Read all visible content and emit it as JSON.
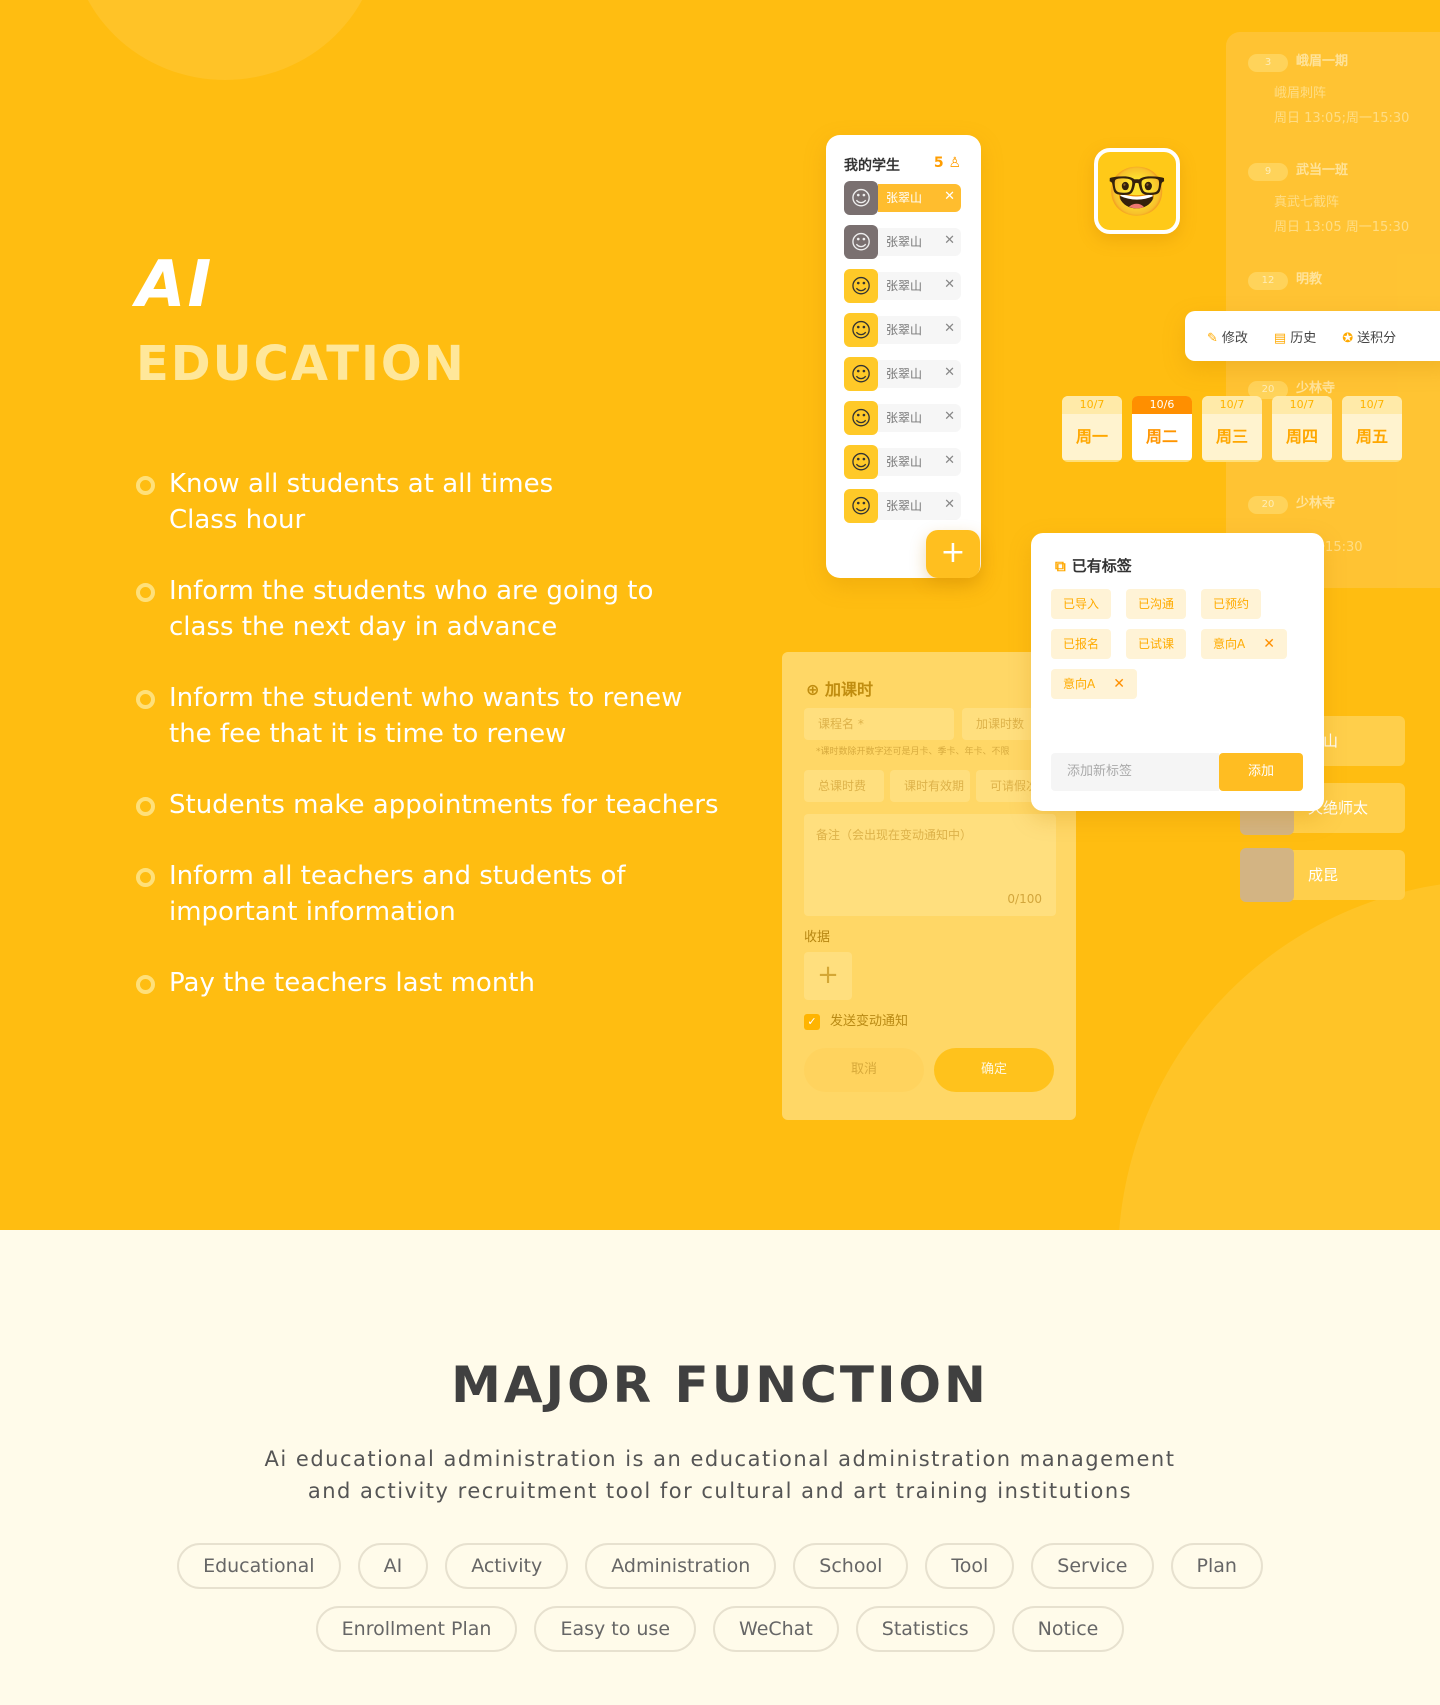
{
  "hero": {
    "title_ai": "AI",
    "title_education": "EDUCATION",
    "features": [
      "Know all students at all times\nClass hour",
      "Inform the students who are going to\nclass the next day in advance",
      "Inform the student who wants to renew\nthe fee that it is time to renew",
      "Students make appointments for teachers",
      "Inform all teachers and students of\nimportant information",
      "Pay the teachers last month"
    ]
  },
  "students_panel": {
    "title": "我的学生",
    "count": "5",
    "students": [
      "张翠山",
      "张翠山",
      "张翠山",
      "张翠山",
      "张翠山",
      "张翠山",
      "张翠山",
      "张翠山"
    ],
    "close_glyph": "✕",
    "add_glyph": "+"
  },
  "schedule": {
    "items": [
      {
        "badge": "3",
        "title": "峨眉一期",
        "line1": "峨眉刺阵",
        "line2": "周日 13:05;周一15:30"
      },
      {
        "badge": "9",
        "title": "武当一班",
        "line1": "真武七截阵",
        "line2": "周日 13:05 周一15:30"
      },
      {
        "badge": "12",
        "title": "明教",
        "line1": "",
        "line2": ""
      },
      {
        "badge": "20",
        "title": "少林寺",
        "line1": "",
        "line2": ""
      },
      {
        "badge": "20",
        "title": "少林寺",
        "line1": "",
        "line2": ":05 周一15:30"
      }
    ]
  },
  "action_bar": {
    "edit": "修改",
    "history": "历史",
    "points": "送积分"
  },
  "days": [
    {
      "date": "10/7",
      "weekday": "周一",
      "active": false
    },
    {
      "date": "10/6",
      "weekday": "周二",
      "active": true
    },
    {
      "date": "10/7",
      "weekday": "周三",
      "active": false
    },
    {
      "date": "10/7",
      "weekday": "周四",
      "active": false
    },
    {
      "date": "10/7",
      "weekday": "周五",
      "active": false
    }
  ],
  "add_class": {
    "title": "加课时",
    "course_name": "课程名 *",
    "hours": "加课时数",
    "hint": "*课时数除开数字还可是月卡、季卡、年卡、不限",
    "total_fee": "总课时费",
    "valid_period": "课时有效期",
    "leave": "可请假次",
    "remark": "备注（会出现在变动通知中）",
    "counter": "0/100",
    "receipt_label": "收据",
    "upload_glyph": "+",
    "notify_label": "发送变动通知",
    "cancel": "取消",
    "confirm": "确定"
  },
  "tags_panel": {
    "title": "已有标签",
    "tags": [
      "已导入",
      "已沟通",
      "已预约",
      "已报名",
      "已试课",
      "意向A",
      "意向A"
    ],
    "input_placeholder": "添加新标签",
    "add_button": "添加"
  },
  "teachers": [
    "翠山",
    "灭绝师太",
    "成昆"
  ],
  "major": {
    "title": "MAJOR FUNCTION",
    "description_line1": "Ai educational administration is an educational administration management",
    "description_line2": "and activity recruitment tool for cultural and art training institutions",
    "chips_row1": [
      "Educational",
      "AI",
      "Activity",
      "Administration",
      "School",
      "Tool",
      "Service",
      "Plan"
    ],
    "chips_row2": [
      "Enrollment Plan",
      "Easy to use",
      "WeChat",
      "Statistics",
      "Notice"
    ]
  },
  "colors": {
    "brand": "#ffbd11",
    "accent": "#ff9500",
    "background": "#fffbea",
    "text_dark": "#404040"
  }
}
